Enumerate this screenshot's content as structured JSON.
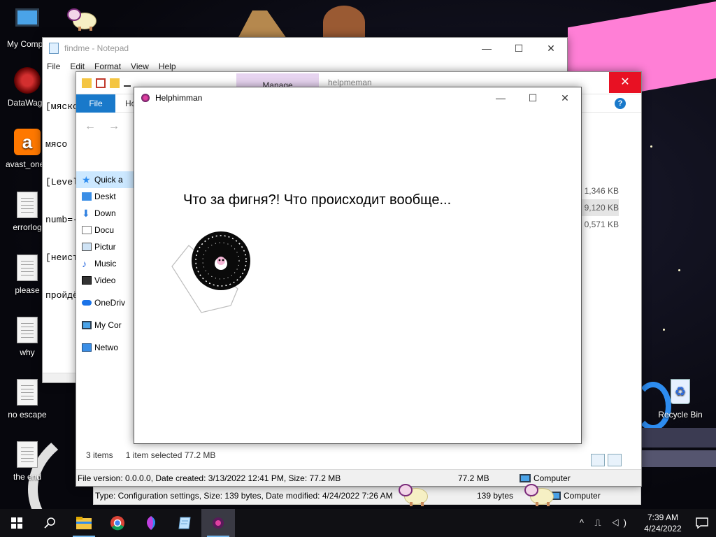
{
  "desktop": {
    "icons": [
      {
        "label": "My Compu",
        "icon": "monitor-icon"
      },
      {
        "label": "DataWago",
        "icon": "datawagon-icon"
      },
      {
        "label": "avast_one_",
        "icon": "avast-icon"
      },
      {
        "label": "errorlog",
        "icon": "text-file-icon"
      },
      {
        "label": "please",
        "icon": "text-file-icon"
      },
      {
        "label": "why",
        "icon": "text-file-icon"
      },
      {
        "label": "no escape",
        "icon": "text-file-icon"
      },
      {
        "label": "the end",
        "icon": "text-file-icon"
      },
      {
        "label": "Recycle Bin",
        "icon": "recycle-bin-icon"
      }
    ]
  },
  "notepad": {
    "title": "findme - Notepad",
    "menu": [
      "File",
      "Edit",
      "Format",
      "View",
      "Help"
    ],
    "lines": [
      "[мяско",
      "мясо ",
      "[Level",
      "numb=-",
      "[неист",
      "пройдё"
    ],
    "controls": {
      "minimize": "—",
      "maximize": "☐",
      "close": "✕"
    }
  },
  "explorer": {
    "manage_tab": "Manage",
    "window_name": "helpmeman",
    "close": "✕",
    "ribbon": {
      "file_tab": "File",
      "home_tab": "Ho"
    },
    "help": "?",
    "nav": [
      {
        "label": "Quick a",
        "icon": "star-icon",
        "selected": true
      },
      {
        "label": "Deskt",
        "icon": "desktop-folder-icon"
      },
      {
        "label": "Down",
        "icon": "download-icon"
      },
      {
        "label": "Docu",
        "icon": "document-icon"
      },
      {
        "label": "Pictur",
        "icon": "pictures-icon"
      },
      {
        "label": "Music",
        "icon": "music-icon"
      },
      {
        "label": "Video",
        "icon": "video-icon"
      },
      {
        "label": "OneDriv",
        "icon": "cloud-icon"
      },
      {
        "label": "My Cor",
        "icon": "monitor-icon"
      },
      {
        "label": "Netwo",
        "icon": "network-icon"
      }
    ],
    "sizes": [
      "1,346 KB",
      "9,120 KB",
      "0,571 KB"
    ],
    "status": {
      "items": "3 items",
      "selected": "1 item selected  77.2 MB"
    },
    "info": {
      "details": "File version: 0.0.0.0, Date created: 3/13/2022 12:41 PM, Size: 77.2 MB",
      "size": "77.2 MB",
      "location": "Computer"
    }
  },
  "explorer2": {
    "details": "Type: Configuration settings, Size: 139 bytes, Date modified: 4/24/2022 7:26 AM",
    "size": "139 bytes",
    "location": "Computer"
  },
  "dialog": {
    "title": "Helphimman",
    "message": "Что за фигня?! Что происходит вообще...",
    "controls": {
      "minimize": "—",
      "maximize": "☐",
      "close": "✕"
    }
  },
  "taskbar": {
    "apps": [
      "start-icon",
      "search-icon",
      "file-explorer-icon",
      "chrome-icon",
      "paint3d-icon",
      "notepad-icon",
      "helphimman-icon"
    ],
    "tray_icons": "^ ⎍ ◁)",
    "time": "7:39 AM",
    "date": "4/24/2022"
  },
  "colors": {
    "accent": "#1979ca",
    "close_red": "#e81123",
    "manage_tab": "#e7d4f0",
    "pink_deco": "#ff7fd6"
  }
}
